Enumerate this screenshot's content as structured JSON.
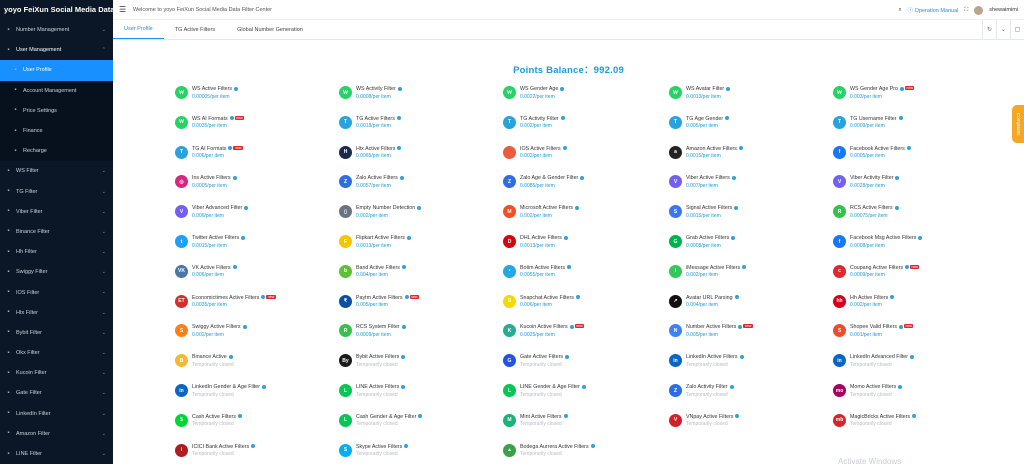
{
  "brand": "yoyo FeiXun Social Media Data F...",
  "sidebar": [
    {
      "label": "Number Management",
      "icon": "phone",
      "chev": "⌄",
      "kind": ""
    },
    {
      "label": "User Management",
      "icon": "user",
      "chev": "⌃",
      "kind": "open"
    },
    {
      "label": "User Profile",
      "icon": "person",
      "chev": "",
      "kind": "sub active"
    },
    {
      "label": "Account Management",
      "icon": "account",
      "chev": "",
      "kind": "sub"
    },
    {
      "label": "Price Settings",
      "icon": "price",
      "chev": "",
      "kind": "sub"
    },
    {
      "label": "Finance",
      "icon": "finance",
      "chev": "",
      "kind": "sub"
    },
    {
      "label": "Recharge",
      "icon": "recharge",
      "chev": "",
      "kind": "sub"
    },
    {
      "label": "WS Filter",
      "icon": "filter",
      "chev": "⌄",
      "kind": ""
    },
    {
      "label": "TG Filter",
      "icon": "filter",
      "chev": "⌄",
      "kind": ""
    },
    {
      "label": "Viber Filter",
      "icon": "filter",
      "chev": "⌄",
      "kind": ""
    },
    {
      "label": "Binance Filter",
      "icon": "filter",
      "chev": "⌄",
      "kind": ""
    },
    {
      "label": "Hh Filter",
      "icon": "filter",
      "chev": "⌄",
      "kind": ""
    },
    {
      "label": "Swiggy Filter",
      "icon": "filter",
      "chev": "⌄",
      "kind": ""
    },
    {
      "label": "IOS Filter",
      "icon": "filter",
      "chev": "⌄",
      "kind": ""
    },
    {
      "label": "Htx Filter",
      "icon": "filter",
      "chev": "⌄",
      "kind": ""
    },
    {
      "label": "Bybit Filter",
      "icon": "filter",
      "chev": "⌄",
      "kind": ""
    },
    {
      "label": "Okx Filter",
      "icon": "filter",
      "chev": "⌄",
      "kind": ""
    },
    {
      "label": "Kucoin Filter",
      "icon": "filter",
      "chev": "⌄",
      "kind": ""
    },
    {
      "label": "Gate Filter",
      "icon": "filter",
      "chev": "⌄",
      "kind": ""
    },
    {
      "label": "LinkedIn Filter",
      "icon": "filter",
      "chev": "⌄",
      "kind": ""
    },
    {
      "label": "Amazon Filter",
      "icon": "filter",
      "chev": "⌄",
      "kind": ""
    },
    {
      "label": "LINE Filter",
      "icon": "filter",
      "chev": "⌄",
      "kind": ""
    }
  ],
  "topbar": {
    "welcome": "Welcome to yoyo FeiXun Social Media Data Filter Center",
    "manual": "Operation Manual",
    "username": "shewaimimi"
  },
  "tabs": [
    "User Profile",
    "TG Active Filters",
    "Global Number Generation"
  ],
  "balance": "Points Balance：992.09",
  "sidetab": "Complaints",
  "watermark": "Activate Windows",
  "services": [
    {
      "title": "WS Active Filters",
      "price": "0.00005/per item",
      "icon": "W",
      "color": "#25d366",
      "new": false
    },
    {
      "title": "WS Activity Filter",
      "price": "0.0008/per item",
      "icon": "W",
      "color": "#25d366",
      "new": false
    },
    {
      "title": "WS Gender Age",
      "price": "0.0022/per item",
      "icon": "W",
      "color": "#25d366",
      "new": false
    },
    {
      "title": "WS Avatar Filter",
      "price": "0.0013/per item",
      "icon": "W",
      "color": "#25d366",
      "new": false
    },
    {
      "title": "WS Gender Age Pro",
      "price": "0.003/per item",
      "icon": "W",
      "color": "#25d366",
      "new": true
    },
    {
      "title": "WS AI Formats",
      "price": "0.0035/per item",
      "icon": "W",
      "color": "#25d366",
      "new": true
    },
    {
      "title": "TG Active Filters",
      "price": "0.0018/per item",
      "icon": "T",
      "color": "#2aa3dc",
      "new": false
    },
    {
      "title": "TG Activity Filter",
      "price": "0.002/per item",
      "icon": "T",
      "color": "#2aa3dc",
      "new": false
    },
    {
      "title": "TG Age Gender",
      "price": "0.005/per item",
      "icon": "T",
      "color": "#2aa3dc",
      "new": false
    },
    {
      "title": "TG Username Filter",
      "price": "0.0009/per item",
      "icon": "T",
      "color": "#2aa3dc",
      "new": false
    },
    {
      "title": "TG AI Formats",
      "price": "0.006/per item",
      "icon": "T",
      "color": "#2aa3dc",
      "new": true
    },
    {
      "title": "Htx Active Filters",
      "price": "0.0065/per item",
      "icon": "H",
      "color": "#1c2a4a",
      "new": false
    },
    {
      "title": "IOS Active Filters",
      "price": "0.002/per item",
      "icon": "",
      "color": "#e85d3b",
      "new": false
    },
    {
      "title": "Amazon Active Filters",
      "price": "0.0015/per item",
      "icon": "a",
      "color": "#222222",
      "new": false
    },
    {
      "title": "Facebook Active Filters",
      "price": "0.0005/per item",
      "icon": "f",
      "color": "#1877f2",
      "new": false
    },
    {
      "title": "Ins Active Filters",
      "price": "0.0005/per item",
      "icon": "◎",
      "color": "#d6287c",
      "new": false
    },
    {
      "title": "Zalo Active Filters",
      "price": "0.0057/per item",
      "icon": "Z",
      "color": "#2d6fe0",
      "new": false
    },
    {
      "title": "Zalo Age & Gender Filter",
      "price": "0.0085/per item",
      "icon": "Z",
      "color": "#2d6fe0",
      "new": false
    },
    {
      "title": "Viber Active Filters",
      "price": "0.007/per item",
      "icon": "V",
      "color": "#7360f2",
      "new": false
    },
    {
      "title": "Viber Activity Filter",
      "price": "0.0028/per item",
      "icon": "V",
      "color": "#7360f2",
      "new": false
    },
    {
      "title": "Viber Advanced Filter",
      "price": "0.006/per item",
      "icon": "V",
      "color": "#7360f2",
      "new": false
    },
    {
      "title": "Empty Number Detection",
      "price": "0.002/per item",
      "icon": "▯",
      "color": "#6b7280",
      "new": false
    },
    {
      "title": "Microsoft Active Filters",
      "price": "0.002/per item",
      "icon": "M",
      "color": "#f25022",
      "new": false
    },
    {
      "title": "Signal Active Filters",
      "price": "0.0015/per item",
      "icon": "S",
      "color": "#3a76f0",
      "new": false
    },
    {
      "title": "RCS Active Filters",
      "price": "0.00075/per item",
      "icon": "R",
      "color": "#36c24a",
      "new": false
    },
    {
      "title": "Twitter Active Filters",
      "price": "0.0015/per item",
      "icon": "t",
      "color": "#1da1f2",
      "new": false
    },
    {
      "title": "Flipkart Active Filters",
      "price": "0.0013/per item",
      "icon": "F",
      "color": "#f7c500",
      "new": false
    },
    {
      "title": "DHL Active Filters",
      "price": "0.0013/per item",
      "icon": "D",
      "color": "#d40511",
      "new": false
    },
    {
      "title": "Grab Active Filters",
      "price": "0.0008/per item",
      "icon": "G",
      "color": "#00b14f",
      "new": false
    },
    {
      "title": "Facebook Msg Active Filters",
      "price": "0.0008/per item",
      "icon": "f",
      "color": "#1877f2",
      "new": false
    },
    {
      "title": "VK Active Filters",
      "price": "0.006/per item",
      "icon": "VK",
      "color": "#4a76a8",
      "new": false
    },
    {
      "title": "Band Active Filters",
      "price": "0.004/per item",
      "icon": "b",
      "color": "#5bc236",
      "new": false
    },
    {
      "title": "Botim Active Filters",
      "price": "0.0055/per item",
      "icon": "•",
      "color": "#21a9e1",
      "new": false
    },
    {
      "title": "iMessage Active Filters",
      "price": "0.002/per item",
      "icon": "i",
      "color": "#34c759",
      "new": false
    },
    {
      "title": "Coupang Active Filters",
      "price": "0.0009/per item",
      "icon": "c",
      "color": "#e0292e",
      "new": true
    },
    {
      "title": "Economictimes Active Filters",
      "price": "0.0035/per item",
      "icon": "ET",
      "color": "#d32f2f",
      "new": true
    },
    {
      "title": "Paytm Active Filters",
      "price": "0.005/per item",
      "icon": "₹",
      "color": "#0b4fa2",
      "new": true
    },
    {
      "title": "Snapchat Active Filters",
      "price": "0.006/per item",
      "icon": "S",
      "color": "#f7d800",
      "new": false
    },
    {
      "title": "Avatar URL Parsing",
      "price": "0.004/per item",
      "icon": "↗",
      "color": "#111111",
      "new": false
    },
    {
      "title": "Hh Active Filters",
      "price": "0.002/per item",
      "icon": "hh",
      "color": "#d6001c",
      "new": false
    },
    {
      "title": "Swiggy Active Filters",
      "price": "0.002/per item",
      "icon": "S",
      "color": "#fc8019",
      "new": false
    },
    {
      "title": "RCS System Filter",
      "price": "0.0009/per item",
      "icon": "R",
      "color": "#36c24a",
      "new": false
    },
    {
      "title": "Kucoin Active Filters",
      "price": "0.0025/per item",
      "icon": "K",
      "color": "#23af91",
      "new": true
    },
    {
      "title": "Number Active Filters",
      "price": "0.005/per item",
      "icon": "N",
      "color": "#3b82f6",
      "new": true
    },
    {
      "title": "Shopee Valid Filters",
      "price": "0.001/per item",
      "icon": "S",
      "color": "#ee4d2d",
      "new": true
    },
    {
      "title": "Binance Active",
      "price": "Temporarily closed",
      "icon": "B",
      "color": "#f3ba2f",
      "new": false
    },
    {
      "title": "Bybit Active Filters",
      "price": "Temporarily closed",
      "icon": "By",
      "color": "#1a1a1a",
      "new": false
    },
    {
      "title": "Gate Active Filters",
      "price": "Temporarily closed",
      "icon": "G",
      "color": "#2354e6",
      "new": false
    },
    {
      "title": "LinkedIn Active Filters",
      "price": "Temporarily closed",
      "icon": "in",
      "color": "#0a66c2",
      "new": false
    },
    {
      "title": "LinkedIn Advanced Filter",
      "price": "Temporarily closed",
      "icon": "in",
      "color": "#0a66c2",
      "new": false
    },
    {
      "title": "LinkedIn Gender & Age Filter",
      "price": "Temporarily closed",
      "icon": "in",
      "color": "#0a66c2",
      "new": false
    },
    {
      "title": "LINE Active Filters",
      "price": "Temporarily closed",
      "icon": "L",
      "color": "#06c755",
      "new": false
    },
    {
      "title": "LINE Gender & Age Filter",
      "price": "Temporarily closed",
      "icon": "L",
      "color": "#06c755",
      "new": false
    },
    {
      "title": "Zalo Activity Filter",
      "price": "Temporarily closed",
      "icon": "Z",
      "color": "#2d6fe0",
      "new": false
    },
    {
      "title": "Momo Active Filters",
      "price": "Temporarily closed",
      "icon": "mo",
      "color": "#a50064",
      "new": false
    },
    {
      "title": "Cash Active Filters",
      "price": "Temporarily closed",
      "icon": "$",
      "color": "#00d632",
      "new": false
    },
    {
      "title": "Cash Gender & Age Filter",
      "price": "Temporarily closed",
      "icon": "L",
      "color": "#06c755",
      "new": false
    },
    {
      "title": "Mint Active Filters",
      "price": "Temporarily closed",
      "icon": "M",
      "color": "#1bb27a",
      "new": false
    },
    {
      "title": "VNpay Active Filters",
      "price": "Temporarily closed",
      "icon": "V",
      "color": "#d0202a",
      "new": false
    },
    {
      "title": "MagicBricks Active Filters",
      "price": "Temporarily closed",
      "icon": "mb",
      "color": "#d8232a",
      "new": false
    },
    {
      "title": "ICICI Bank Active Filters",
      "price": "Temporarily closed",
      "icon": "i",
      "color": "#ad1e23",
      "new": false
    },
    {
      "title": "Skype Active Filters",
      "price": "Temporarily closed",
      "icon": "S",
      "color": "#00aff0",
      "new": false
    },
    {
      "title": "Bodega Aurrera Active Filters",
      "price": "Temporarily closed",
      "icon": "▲",
      "color": "#3aa14b",
      "new": false
    }
  ]
}
